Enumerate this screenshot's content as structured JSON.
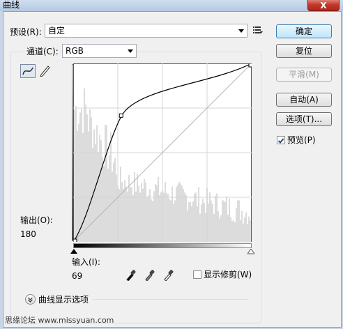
{
  "window": {
    "title": "曲线",
    "close_label": "X"
  },
  "preset": {
    "label": "预设(R):",
    "value": "自定",
    "menu_icon": "preset-options-icon"
  },
  "channel": {
    "label": "通道(C):",
    "value": "RGB"
  },
  "buttons": {
    "ok": "确定",
    "reset": "复位",
    "smooth": "平滑(M)",
    "auto": "自动(A)",
    "options": "选项(T)..."
  },
  "preview": {
    "label": "预览(P)",
    "checked": true
  },
  "output": {
    "label": "输出(O):",
    "value": "180"
  },
  "input": {
    "label": "输入(I):",
    "value": "69"
  },
  "show_clipping": {
    "label": "显示修剪(W)",
    "checked": false
  },
  "curve_display": {
    "label": "曲线显示选项"
  },
  "watermark": "思缘论坛 www.missyuan.com",
  "curve": {
    "points": [
      [
        0,
        0
      ],
      [
        69,
        180
      ],
      [
        255,
        255
      ]
    ]
  },
  "colors": {
    "accent": "#3c7fb1",
    "graph_bg": "#ffffff",
    "histogram": "#dcdcdc",
    "grid": "#d4d4d4"
  }
}
